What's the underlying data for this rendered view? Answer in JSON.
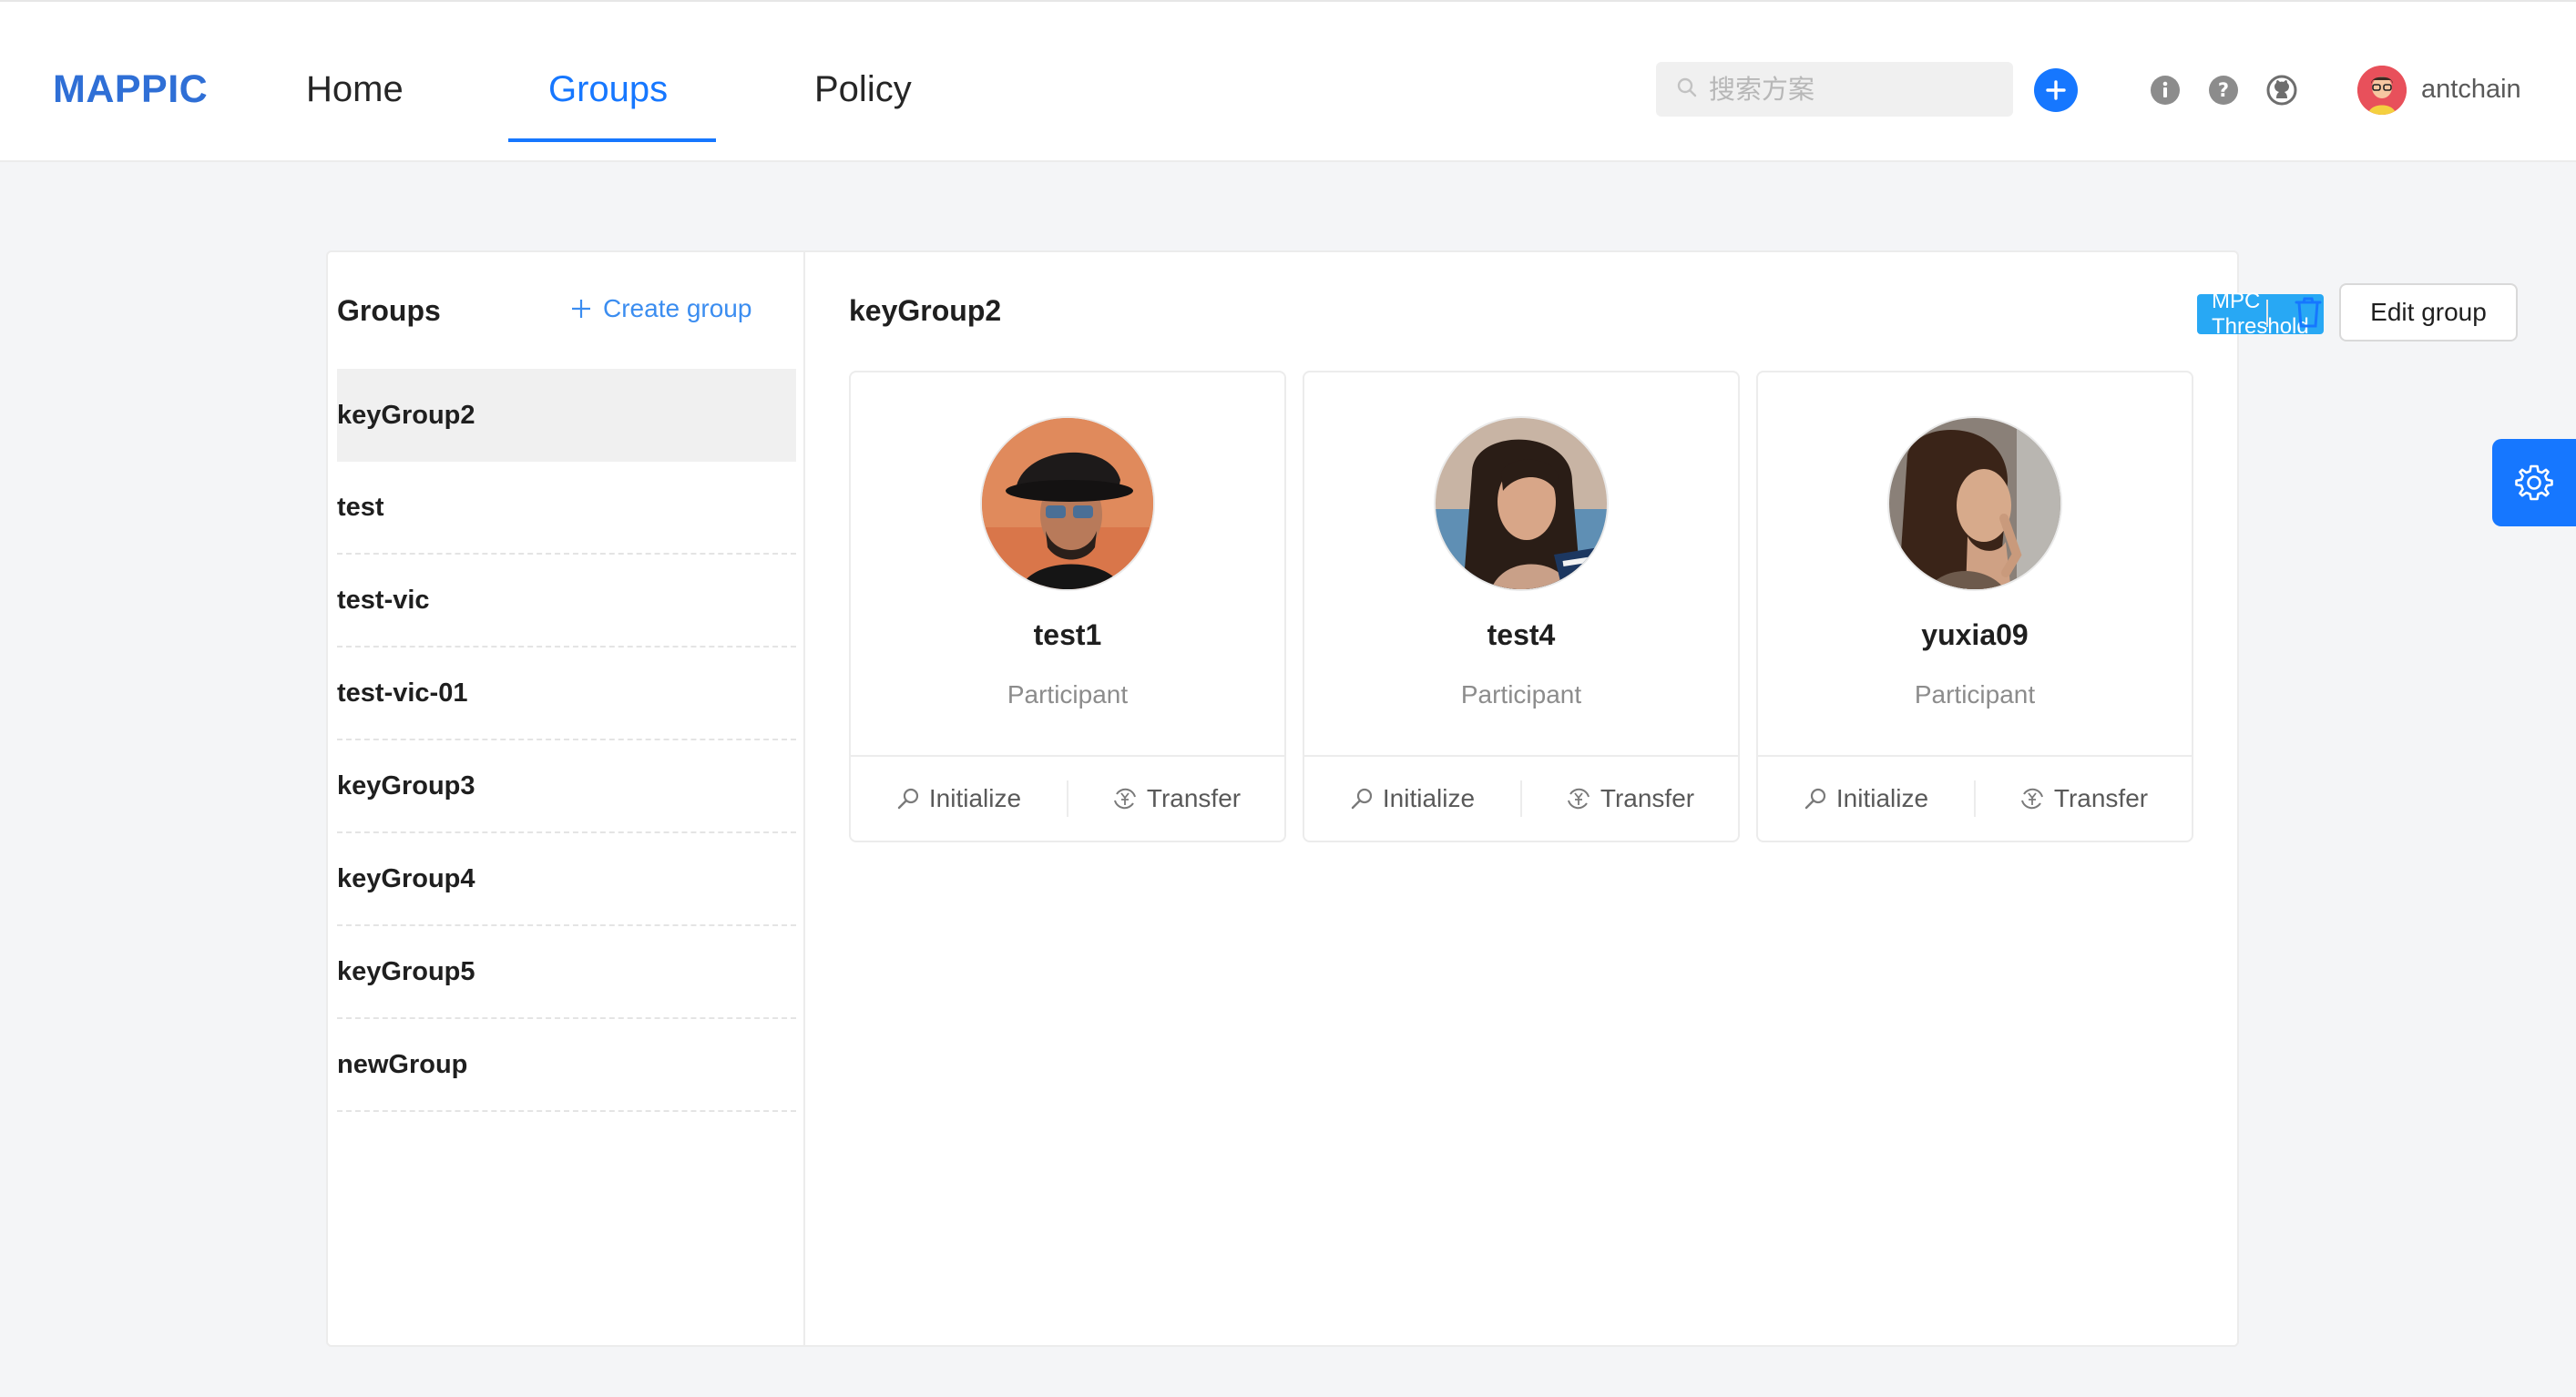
{
  "header": {
    "logo": "MAPPIC",
    "nav": [
      {
        "label": "Home",
        "active": false
      },
      {
        "label": "Groups",
        "active": true
      },
      {
        "label": "Policy",
        "active": false
      }
    ],
    "search_placeholder": "搜索方案",
    "user_name": "antchain"
  },
  "sidebar": {
    "title": "Groups",
    "create_label": "Create group",
    "groups": [
      "keyGroup2",
      "test",
      "test-vic",
      "test-vic-01",
      "keyGroup3",
      "keyGroup4",
      "keyGroup5",
      "newGroup"
    ],
    "selected": "keyGroup2"
  },
  "detail": {
    "title": "keyGroup2",
    "badge": "MPC Threshold",
    "edit_label": "Edit group",
    "members": [
      {
        "name": "test1",
        "role": "Participant",
        "initialize": "Initialize",
        "transfer": "Transfer"
      },
      {
        "name": "test4",
        "role": "Participant",
        "initialize": "Initialize",
        "transfer": "Transfer"
      },
      {
        "name": "yuxia09",
        "role": "Participant",
        "initialize": "Initialize",
        "transfer": "Transfer"
      }
    ]
  },
  "colors": {
    "accent": "#1677ff",
    "badge": "#28a8f4",
    "logo": "#2f6fd6"
  },
  "icons": {
    "search": "search-icon",
    "add": "plus-icon",
    "info": "info-icon",
    "help": "question-icon",
    "github": "github-icon",
    "delete": "trash-icon",
    "initialize": "key-icon",
    "transfer": "transfer-icon",
    "settings": "gear-icon"
  }
}
